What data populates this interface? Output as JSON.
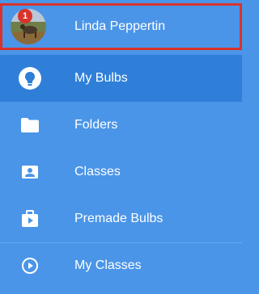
{
  "profile": {
    "name": "Linda Peppertin",
    "notification_count": "1"
  },
  "menu": {
    "items": [
      {
        "label": "My Bulbs",
        "icon": "bulb-icon"
      },
      {
        "label": "Folders",
        "icon": "folder-icon"
      },
      {
        "label": "Classes",
        "icon": "classes-icon"
      },
      {
        "label": "Premade Bulbs",
        "icon": "premade-bulbs-icon"
      },
      {
        "label": "My Classes",
        "icon": "play-circle-icon"
      }
    ]
  },
  "colors": {
    "background": "#4a95e8",
    "active_background": "#2f7fd8",
    "highlight_border": "#d9332b",
    "badge": "#d9332b"
  }
}
